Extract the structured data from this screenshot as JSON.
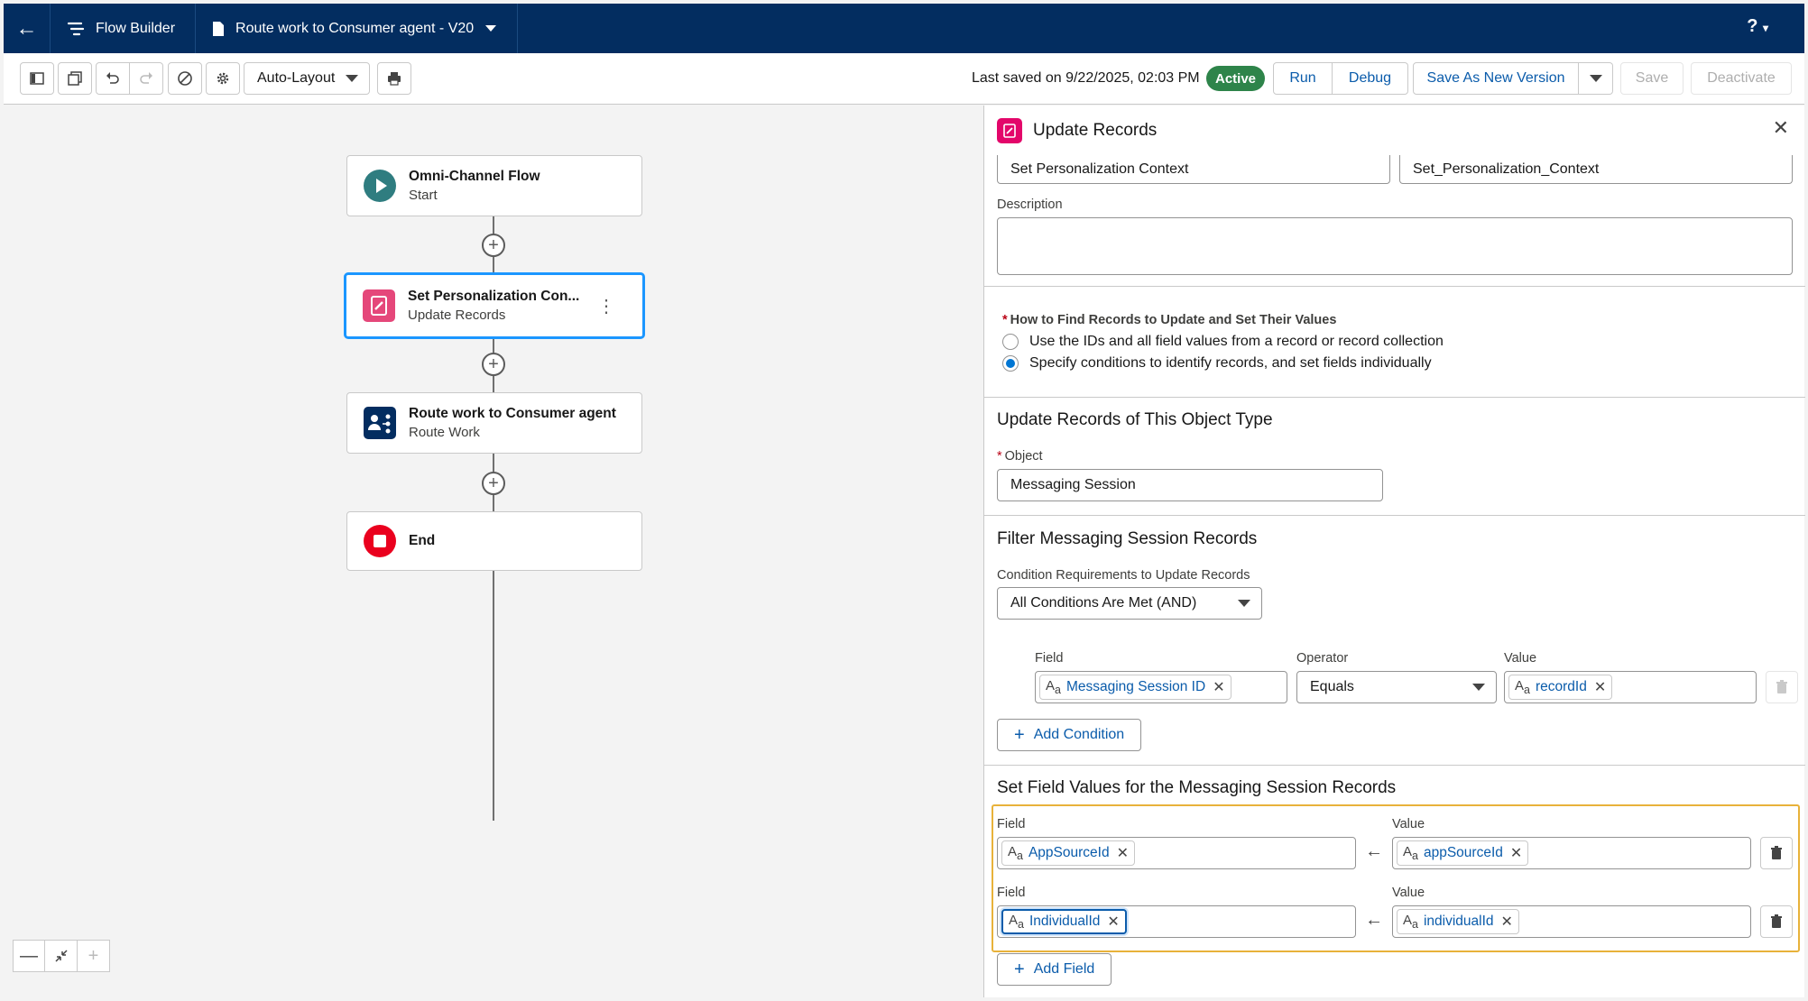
{
  "topbar": {
    "app_name": "Flow Builder",
    "flow_name": "Route work to Consumer agent - V20",
    "help": "?"
  },
  "toolbar": {
    "layout_select": "Auto-Layout",
    "last_saved": "Last saved on 9/22/2025, 02:03 PM",
    "status": "Active",
    "run": "Run",
    "debug": "Debug",
    "save_as_new_version": "Save As New Version",
    "save": "Save",
    "deactivate": "Deactivate"
  },
  "canvas": {
    "nodes": [
      {
        "title": "Omni-Channel Flow",
        "subtitle": "Start"
      },
      {
        "title": "Set Personalization Con...",
        "subtitle": "Update Records"
      },
      {
        "title": "Route work to Consumer agent",
        "subtitle": "Route Work"
      },
      {
        "title": "End",
        "subtitle": ""
      }
    ]
  },
  "panel": {
    "title": "Update Records",
    "label_value": "Set Personalization Context",
    "api_name_value": "Set_Personalization_Context",
    "description_label": "Description",
    "description_value": "",
    "how_to_find_label": "How to Find Records to Update and Set Their Values",
    "option_1": "Use the IDs and all field values from a record or record collection",
    "option_2": "Specify conditions to identify records, and set fields individually",
    "object_section_title": "Update Records of This Object Type",
    "object_label": "Object",
    "object_value": "Messaging Session",
    "filter_section_title": "Filter Messaging Session Records",
    "condition_req_label": "Condition Requirements to Update Records",
    "condition_req_value": "All Conditions Are Met (AND)",
    "cond_field_label": "Field",
    "cond_operator_label": "Operator",
    "cond_value_label": "Value",
    "cond_field": "Messaging Session ID",
    "cond_operator": "Equals",
    "cond_value": "recordId",
    "add_condition": "Add Condition",
    "set_fields_title": "Set Field Values for the Messaging Session Records",
    "field_label": "Field",
    "value_label": "Value",
    "assignments": [
      {
        "field": "AppSourceId",
        "value": "appSourceId"
      },
      {
        "field": "IndividualId",
        "value": "individualId"
      }
    ],
    "add_field": "Add Field"
  },
  "colors": {
    "header": "#032d60",
    "active": "#2e844a",
    "link": "#0b5cab",
    "highlight": "#e8b23a"
  }
}
